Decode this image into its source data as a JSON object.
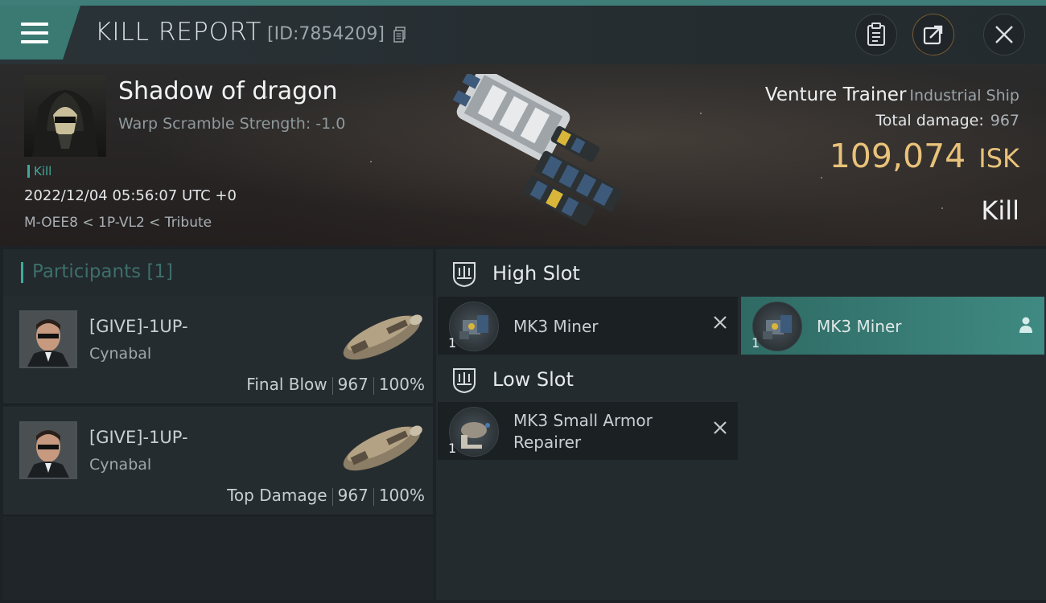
{
  "header": {
    "title": "KILL REPORT",
    "report_id": "[ID:7854209]"
  },
  "victim": {
    "name": "Shadow of dragon",
    "warp_scramble": "Warp Scramble Strength: -1.0",
    "kill_tag": "Kill",
    "timestamp": "2022/12/04 05:56:07 UTC +0",
    "location": "M-OEE8 < 1P-VL2 < Tribute"
  },
  "ship": {
    "name": "Venture Trainer",
    "class": "Industrial Ship",
    "total_damage_label": "Total damage:",
    "total_damage_value": "967",
    "isk_value": "109,074",
    "isk_unit": "ISK",
    "result": "Kill"
  },
  "participants": {
    "title": "Participants [1]",
    "rows": [
      {
        "name": "[GIVE]-1UP-",
        "ship": "Cynabal",
        "role": "Final Blow",
        "damage": "967",
        "percent": "100%"
      },
      {
        "name": "[GIVE]-1UP-",
        "ship": "Cynabal",
        "role": "Top Damage",
        "damage": "967",
        "percent": "100%"
      }
    ]
  },
  "slots": {
    "high": {
      "title": "High Slot",
      "items": [
        {
          "name": "MK3 Miner",
          "qty": "1",
          "state": "destroyed"
        },
        {
          "name": "MK3 Miner",
          "qty": "1",
          "state": "dropped"
        }
      ]
    },
    "low": {
      "title": "Low Slot",
      "items": [
        {
          "name_line1": "MK3 Small Armor",
          "name_line2": "Repairer",
          "qty": "1",
          "state": "destroyed"
        }
      ]
    }
  },
  "colors": {
    "accent": "#3fa99c",
    "isk": "#e9c27a",
    "active_item": "#3f8a82"
  }
}
